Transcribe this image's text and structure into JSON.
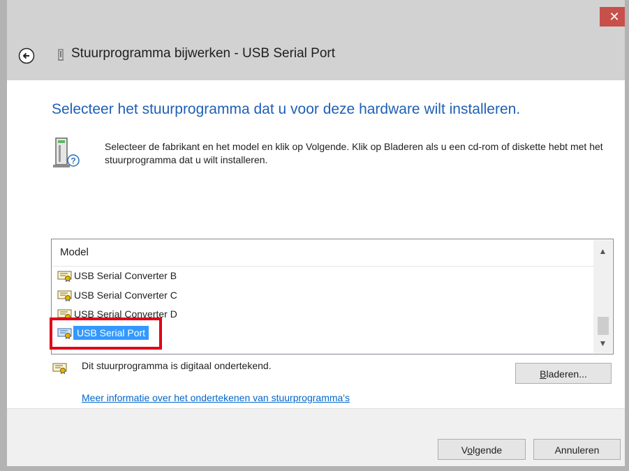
{
  "window": {
    "title": "Stuurprogramma bijwerken - USB Serial Port",
    "close_glyph": "✕",
    "back_glyph": "←"
  },
  "main": {
    "heading": "Selecteer het stuurprogramma dat u voor deze hardware wilt installeren.",
    "description": "Selecteer de fabrikant en het model en klik op Volgende. Klik op Bladeren als u een cd-rom of diskette hebt met het stuurprogramma dat u wilt installeren."
  },
  "model_list": {
    "header": "Model",
    "items": [
      {
        "label": "USB Serial Converter B",
        "selected": false
      },
      {
        "label": "USB Serial Converter C",
        "selected": false
      },
      {
        "label": "USB Serial Converter D",
        "selected": false
      },
      {
        "label": "USB Serial Port",
        "selected": true
      }
    ],
    "scroll_up_glyph": "▲",
    "scroll_down_glyph": "▼"
  },
  "signature": {
    "text": "Dit stuurprogramma is digitaal ondertekend.",
    "link": "Meer informatie over het ondertekenen van stuurprogramma's"
  },
  "buttons": {
    "browse_accel": "B",
    "browse_rest": "laderen...",
    "next_pre": "V",
    "next_accel": "o",
    "next_rest": "lgende",
    "cancel": "Annuleren"
  },
  "colors": {
    "heading": "#1f5fb4",
    "selection": "#3399ff",
    "highlight_box": "#e1001a",
    "close_button": "#c7504b",
    "link": "#0066cc"
  },
  "icons": {
    "back": "back-arrow-icon",
    "title": "device-icon",
    "hardware": "hardware-question-icon",
    "driver": "signed-driver-icon"
  }
}
